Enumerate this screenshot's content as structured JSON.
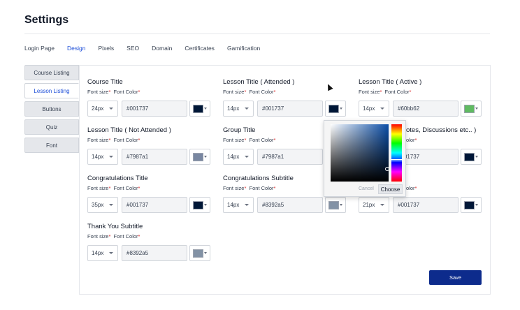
{
  "page": {
    "title": "Settings"
  },
  "tabs": [
    "Login Page",
    "Design",
    "Pixels",
    "SEO",
    "Domain",
    "Certificates",
    "Gamification"
  ],
  "sidebar": [
    "Course Listing",
    "Lesson Listing",
    "Buttons",
    "Quiz",
    "Font"
  ],
  "labels": {
    "font_size": "Font size",
    "font_color": "Font Color",
    "required": "*"
  },
  "fields": {
    "course_title": {
      "title": "Course Title",
      "size": "24px",
      "color": "#001737"
    },
    "lesson_attended": {
      "title": "Lesson Title ( Attended )",
      "size": "14px",
      "color": "#001737"
    },
    "lesson_active": {
      "title": "Lesson Title ( Active )",
      "size": "14px",
      "color": "#60bb62"
    },
    "lesson_not_attended": {
      "title": "Lesson Title ( Not Attended )",
      "size": "14px",
      "color": "#7987a1"
    },
    "group_title": {
      "title": "Group Title",
      "size": "14px",
      "color": "#7987a1"
    },
    "notes": {
      "title": "otes, Discussions etc.. )",
      "size": "",
      "color": "#001737"
    },
    "congrats_title": {
      "title": "Congratulations Title",
      "size": "35px",
      "color": "#001737"
    },
    "congrats_subtitle": {
      "title": "Congratulations Subtitle",
      "size": "14px",
      "color": "#8392a5"
    },
    "third_row_right": {
      "title": "",
      "size": "21px",
      "color": "#001737"
    },
    "thank_you_subtitle": {
      "title": "Thank You Subtitle",
      "size": "14px",
      "color": "#8392a5"
    }
  },
  "picker": {
    "cancel": "Cancel",
    "choose": "Choose"
  },
  "save": "Save"
}
